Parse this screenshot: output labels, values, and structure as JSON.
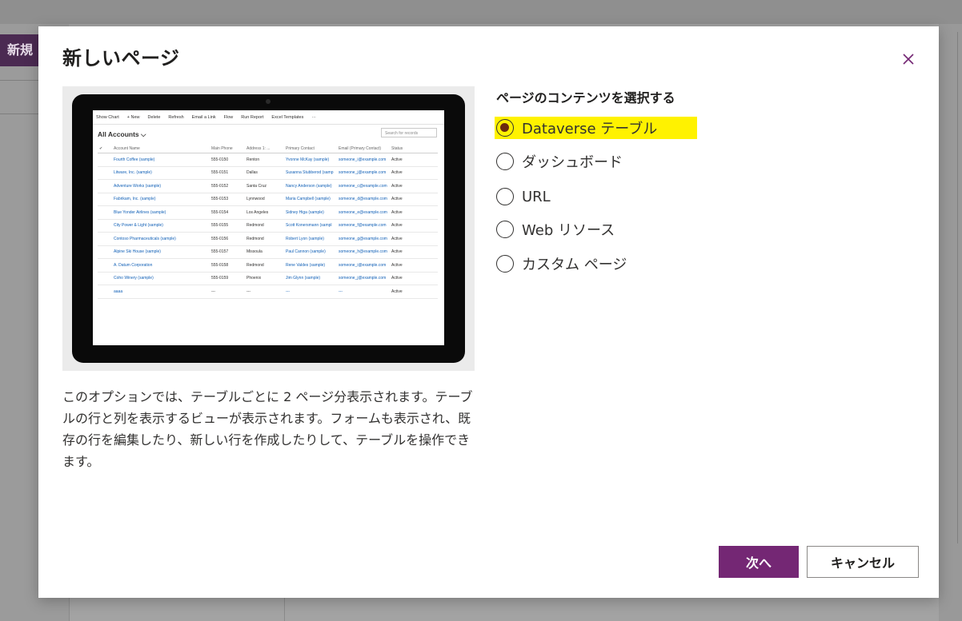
{
  "background": {
    "new_button": "新規"
  },
  "dialog": {
    "title": "新しいページ",
    "description": "このオプションでは、テーブルごとに 2 ページ分表示されます。テーブルの行と列を表示するビューが表示されます。フォームも表示され、既存の行を編集したり、新しい行を作成したりして、テーブルを操作できます。",
    "options_title": "ページのコンテンツを選択する",
    "options": [
      {
        "label": "Dataverse テーブル",
        "selected": true
      },
      {
        "label": "ダッシュボード",
        "selected": false
      },
      {
        "label": "URL",
        "selected": false
      },
      {
        "label": "Web リソース",
        "selected": false
      },
      {
        "label": "カスタム ページ",
        "selected": false
      }
    ],
    "next_label": "次へ",
    "cancel_label": "キャンセル"
  },
  "preview": {
    "toolbar": [
      "Show Chart",
      "+ New",
      "Delete",
      "Refresh",
      "Email a Link",
      "Flow",
      "Run Report",
      "Excel Templates",
      "···"
    ],
    "view_title": "All Accounts",
    "search_placeholder": "Search for records",
    "columns": [
      "Account Name",
      "Main Phone",
      "Address 1: ...",
      "Primary Contact",
      "Email (Primary Contact)",
      "Status"
    ],
    "rows": [
      [
        "Fourth Coffee (sample)",
        "555-0150",
        "Renton",
        "Yvonne McKay (sample)",
        "someone_i@example.com",
        "Active"
      ],
      [
        "Litware, Inc. (sample)",
        "555-0151",
        "Dallas",
        "Susanna Stubberod (samp",
        "someone_j@example.com",
        "Active"
      ],
      [
        "Adventure Works (sample)",
        "555-0152",
        "Santa Cruz",
        "Nancy Anderson (sample)",
        "someone_c@example.com",
        "Active"
      ],
      [
        "Fabrikam, Inc. (sample)",
        "555-0153",
        "Lynnwood",
        "Maria Campbell (sample)",
        "someone_d@example.com",
        "Active"
      ],
      [
        "Blue Yonder Airlines (sample)",
        "555-0154",
        "Los Angeles",
        "Sidney Higa (sample)",
        "someone_e@example.com",
        "Active"
      ],
      [
        "City Power & Light (sample)",
        "555-0155",
        "Redmond",
        "Scott Konersmann (sampl",
        "someone_f@example.com",
        "Active"
      ],
      [
        "Contoso Pharmaceuticals (sample)",
        "555-0156",
        "Redmond",
        "Robert Lyon (sample)",
        "someone_g@example.com",
        "Active"
      ],
      [
        "Alpine Ski House (sample)",
        "555-0157",
        "Missoula",
        "Paul Cannon (sample)",
        "someone_h@example.com",
        "Active"
      ],
      [
        "A. Datum Corporation",
        "555-0158",
        "Redmond",
        "Rene Valdes (sample)",
        "someone_i@example.com",
        "Active"
      ],
      [
        "Coho Winery (sample)",
        "555-0159",
        "Phoenix",
        "Jim Glynn (sample)",
        "someone_j@example.com",
        "Active"
      ],
      [
        "aaaa",
        "---",
        "---",
        "---",
        "---",
        "Active"
      ]
    ]
  }
}
